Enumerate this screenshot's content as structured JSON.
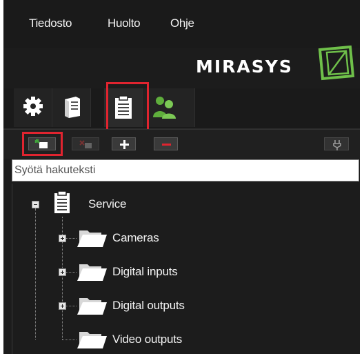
{
  "menu": [
    "Tiedosto",
    "Huolto",
    "Ohje"
  ],
  "brand": {
    "name": "MIRASYS",
    "accent": "#6fc04a"
  },
  "tabs": [
    {
      "icon": "gear-icon"
    },
    {
      "icon": "server-icon"
    },
    {
      "icon": "clipboard-icon",
      "selected": true
    },
    {
      "icon": "users-icon"
    }
  ],
  "toolbar": {
    "buttons": [
      "add-item-icon",
      "remove-item-icon",
      "plus-icon",
      "minus-icon",
      "plug-icon"
    ]
  },
  "search": {
    "placeholder": "Syötä hakuteksti",
    "value": ""
  },
  "tree": {
    "root": {
      "label": "Service",
      "expanded": true
    },
    "children": [
      {
        "label": "Cameras",
        "expandable": true
      },
      {
        "label": "Digital inputs",
        "expandable": true
      },
      {
        "label": "Digital outputs",
        "expandable": true
      },
      {
        "label": "Video outputs",
        "expandable": false
      }
    ]
  },
  "colors": {
    "highlight": "#e0242f",
    "background": "#1c1c1c"
  }
}
